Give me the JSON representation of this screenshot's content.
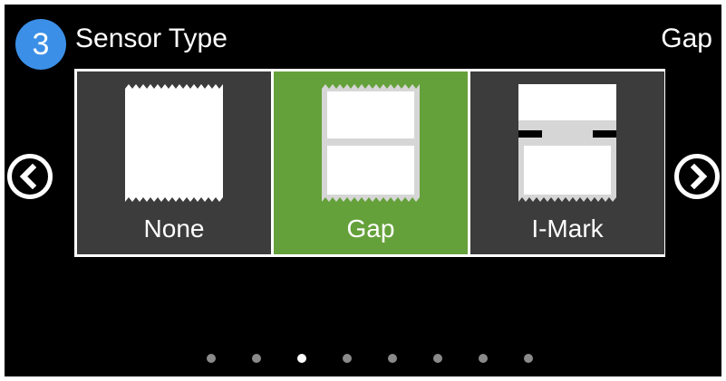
{
  "header": {
    "step_number": "3",
    "title": "Sensor Type",
    "current_value": "Gap"
  },
  "navigation": {
    "prev_icon": "chevron-left-circle-icon",
    "next_icon": "chevron-right-circle-icon"
  },
  "options": [
    {
      "label": "None",
      "icon": "label-roll-no-sensor-icon",
      "selected": false
    },
    {
      "label": "Gap",
      "icon": "label-gap-sensor-icon",
      "selected": true
    },
    {
      "label": "I-Mark",
      "icon": "label-black-mark-sensor-icon",
      "selected": false
    }
  ],
  "pagination": {
    "total_pages": 8,
    "active_page": 3
  },
  "colors": {
    "selected": "#65a13a",
    "unselected": "#3c3c3c",
    "badge": "#3b8fe6",
    "background": "#000000"
  }
}
